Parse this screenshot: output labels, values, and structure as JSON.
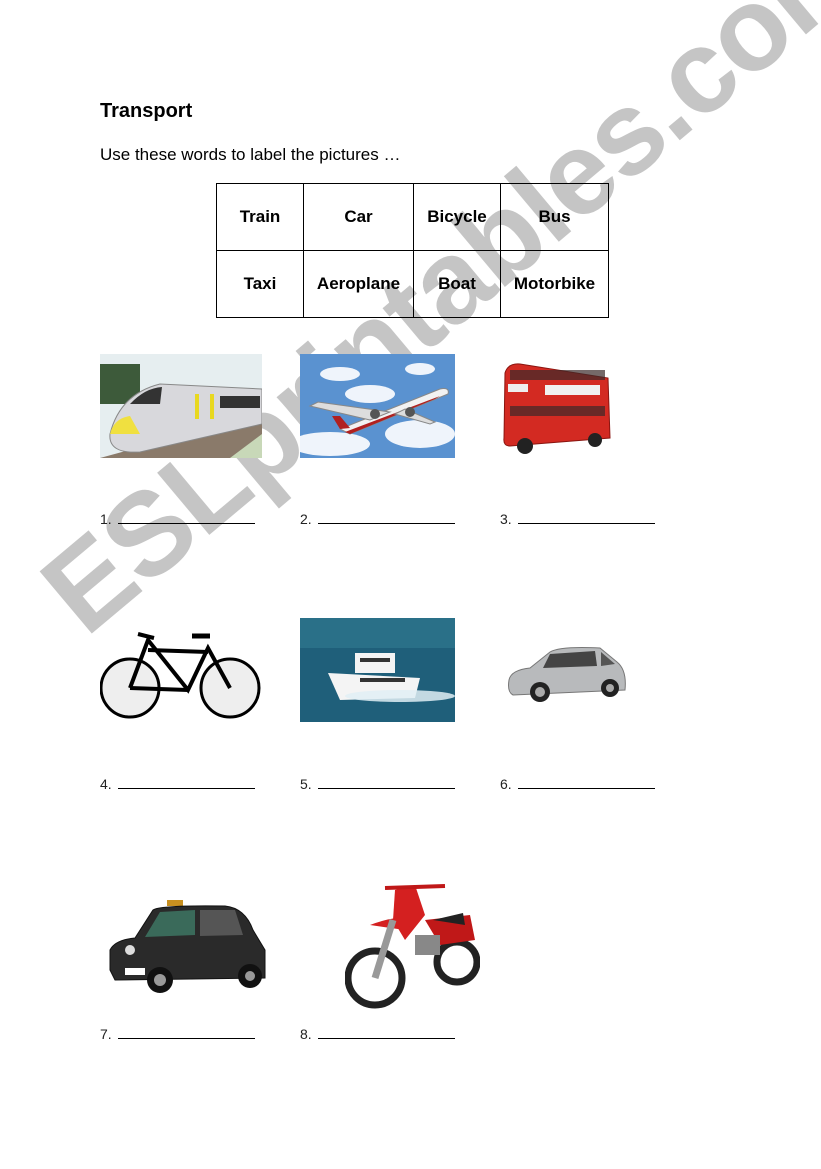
{
  "page": {
    "title": "Transport",
    "instructions": "Use these words to label the pictures …"
  },
  "word_bank": {
    "rows": [
      [
        "Train",
        "Car",
        "Bicycle",
        "Bus"
      ],
      [
        "Taxi",
        "Aeroplane",
        "Boat",
        "Motorbike"
      ]
    ]
  },
  "items": [
    {
      "number": "1.",
      "picture": "train-image",
      "answer": ""
    },
    {
      "number": "2.",
      "picture": "aeroplane-image",
      "answer": ""
    },
    {
      "number": "3.",
      "picture": "bus-image",
      "answer": ""
    },
    {
      "number": "4.",
      "picture": "bicycle-image",
      "answer": ""
    },
    {
      "number": "5.",
      "picture": "boat-image",
      "answer": ""
    },
    {
      "number": "6.",
      "picture": "car-image",
      "answer": ""
    },
    {
      "number": "7.",
      "picture": "taxi-image",
      "answer": ""
    },
    {
      "number": "8.",
      "picture": "motorbike-image",
      "answer": ""
    }
  ],
  "watermark": "ESLprintables.com",
  "colors": {
    "watermark": "#969696",
    "bus_red": "#d32a22",
    "taxi_black": "#222222",
    "sky_blue": "#4a86c8",
    "sea_blue": "#1f5f7a"
  }
}
